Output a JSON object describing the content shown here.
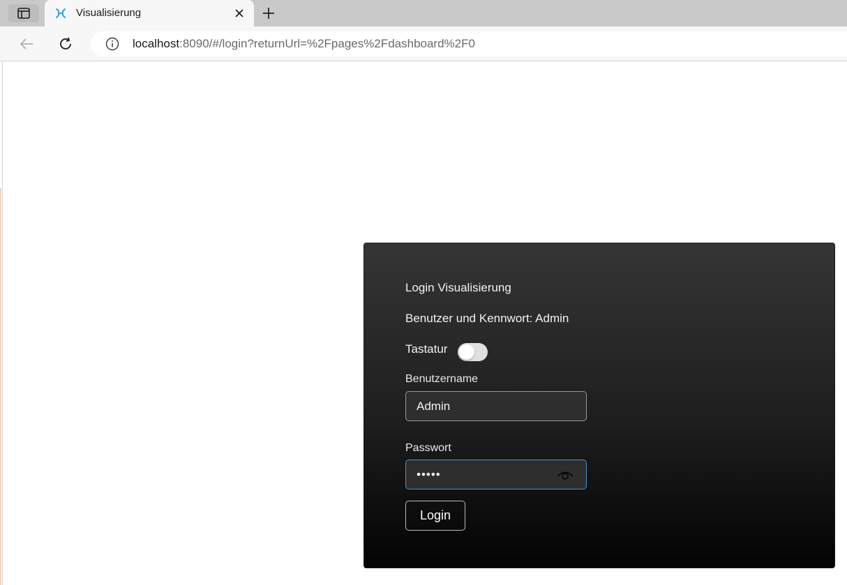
{
  "browser": {
    "tab": {
      "title": "Visualisierung"
    },
    "address": {
      "host": "localhost",
      "rest": ":8090/#/login?returnUrl=%2Fpages%2Fdashboard%2F0"
    },
    "icons": {
      "tab_actions": "tab-actions-icon",
      "favicon": "app-logo-icon",
      "close": "close-icon",
      "new_tab": "plus-icon",
      "back": "arrow-left-icon",
      "reload": "reload-icon",
      "info": "info-icon"
    }
  },
  "login": {
    "title": "Login Visualisierung",
    "hint": "Benutzer und Kennwort: Admin",
    "keyboard_label": "Tastatur",
    "keyboard_enabled": false,
    "username_label": "Benutzername",
    "username_value": "Admin",
    "password_label": "Passwort",
    "password_masked": "•••••",
    "button_label": "Login"
  },
  "colors": {
    "panel_top": "#353535",
    "panel_bottom": "#030303",
    "focus_border": "#4a8fd8",
    "favicon_accent": "#2aa6e0"
  }
}
